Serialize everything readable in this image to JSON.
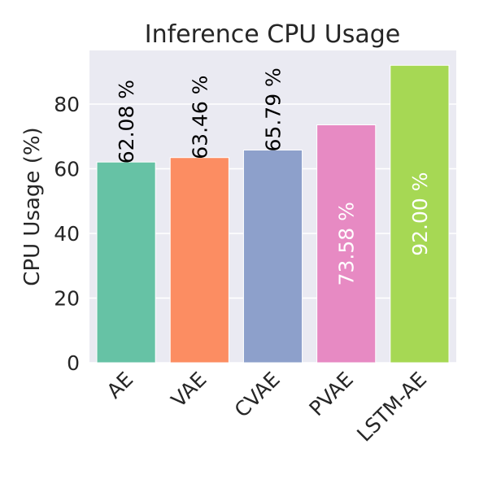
{
  "chart_data": {
    "type": "bar",
    "title": "Inference CPU Usage",
    "ylabel": "CPU Usage (%)",
    "xlabel": "",
    "categories": [
      "AE",
      "VAE",
      "CVAE",
      "PVAE",
      "LSTM-AE"
    ],
    "values": [
      62.08,
      63.46,
      65.79,
      73.58,
      92.0
    ],
    "value_labels": [
      "62.08 %",
      "63.46 %",
      "65.79 %",
      "73.58 %",
      "92.00 %"
    ],
    "value_label_colors": [
      "#000000",
      "#000000",
      "#000000",
      "#ffffff",
      "#ffffff"
    ],
    "colors": [
      "#66c2a5",
      "#fc8d62",
      "#8da0cb",
      "#e78ac3",
      "#a6d854"
    ],
    "ylim": [
      0,
      96.6
    ],
    "yticks": [
      0,
      20,
      40,
      60,
      80
    ],
    "grid": true,
    "background": "#eaeaf2"
  }
}
